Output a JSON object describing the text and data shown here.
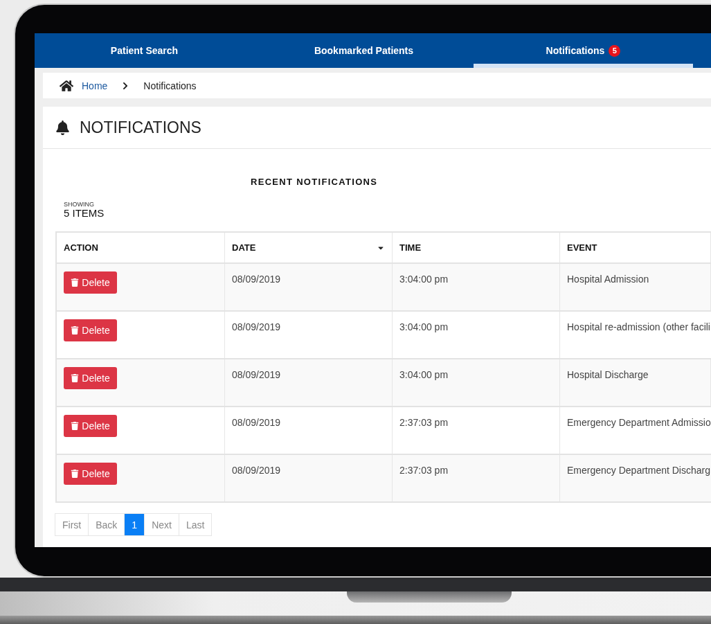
{
  "nav": {
    "tabs": [
      {
        "label": "Patient Search",
        "selected": false
      },
      {
        "label": "Bookmarked Patients",
        "selected": false
      },
      {
        "label": "Notifications",
        "selected": true,
        "badge": "5"
      }
    ]
  },
  "breadcrumb": {
    "items": [
      "Home",
      "Notifications"
    ]
  },
  "page_title": "NOTIFICATIONS",
  "section_title": "RECENT NOTIFICATIONS",
  "showing": {
    "label": "SHOWING",
    "count": "5 ITEMS"
  },
  "table": {
    "columns": [
      {
        "label": "ACTION",
        "sorted": false
      },
      {
        "label": "DATE",
        "sorted": true
      },
      {
        "label": "TIME",
        "sorted": false
      },
      {
        "label": "EVENT",
        "sorted": false
      }
    ],
    "rows": [
      {
        "action": "Delete",
        "date": "08/09/2019",
        "time": "3:04:00 pm",
        "event": "Hospital Admission"
      },
      {
        "action": "Delete",
        "date": "08/09/2019",
        "time": "3:04:00 pm",
        "event": "Hospital re-admission (other facili"
      },
      {
        "action": "Delete",
        "date": "08/09/2019",
        "time": "3:04:00 pm",
        "event": "Hospital Discharge"
      },
      {
        "action": "Delete",
        "date": "08/09/2019",
        "time": "2:37:03 pm",
        "event": "Emergency Department Admissio"
      },
      {
        "action": "Delete",
        "date": "08/09/2019",
        "time": "2:37:03 pm",
        "event": "Emergency Department Discharg"
      }
    ]
  },
  "pagination": [
    {
      "label": "First",
      "selected": false
    },
    {
      "label": "Back",
      "selected": false
    },
    {
      "label": "1",
      "selected": true
    },
    {
      "label": "Next",
      "selected": false
    },
    {
      "label": "Last",
      "selected": false
    }
  ]
}
